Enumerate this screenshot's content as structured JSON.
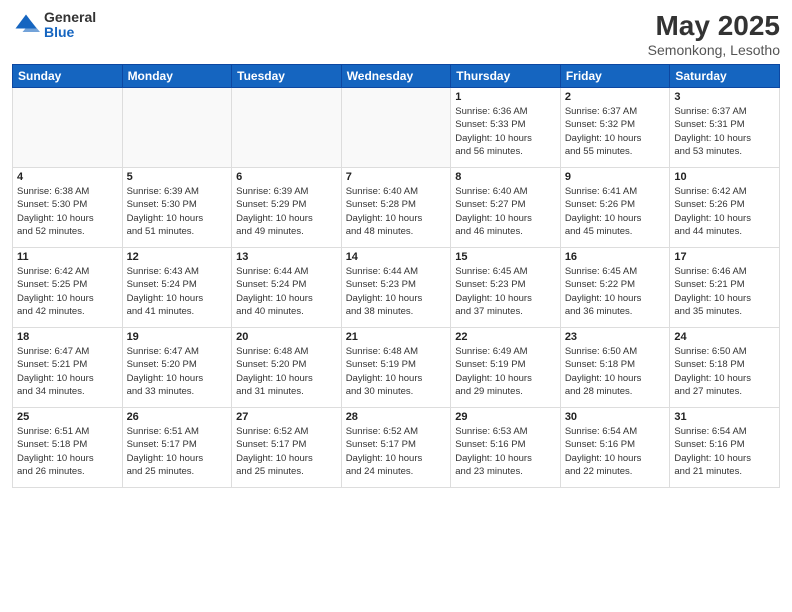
{
  "header": {
    "logo_general": "General",
    "logo_blue": "Blue",
    "title": "May 2025",
    "location": "Semonkong, Lesotho"
  },
  "weekdays": [
    "Sunday",
    "Monday",
    "Tuesday",
    "Wednesday",
    "Thursday",
    "Friday",
    "Saturday"
  ],
  "weeks": [
    [
      {
        "day": "",
        "text": ""
      },
      {
        "day": "",
        "text": ""
      },
      {
        "day": "",
        "text": ""
      },
      {
        "day": "",
        "text": ""
      },
      {
        "day": "1",
        "text": "Sunrise: 6:36 AM\nSunset: 5:33 PM\nDaylight: 10 hours\nand 56 minutes."
      },
      {
        "day": "2",
        "text": "Sunrise: 6:37 AM\nSunset: 5:32 PM\nDaylight: 10 hours\nand 55 minutes."
      },
      {
        "day": "3",
        "text": "Sunrise: 6:37 AM\nSunset: 5:31 PM\nDaylight: 10 hours\nand 53 minutes."
      }
    ],
    [
      {
        "day": "4",
        "text": "Sunrise: 6:38 AM\nSunset: 5:30 PM\nDaylight: 10 hours\nand 52 minutes."
      },
      {
        "day": "5",
        "text": "Sunrise: 6:39 AM\nSunset: 5:30 PM\nDaylight: 10 hours\nand 51 minutes."
      },
      {
        "day": "6",
        "text": "Sunrise: 6:39 AM\nSunset: 5:29 PM\nDaylight: 10 hours\nand 49 minutes."
      },
      {
        "day": "7",
        "text": "Sunrise: 6:40 AM\nSunset: 5:28 PM\nDaylight: 10 hours\nand 48 minutes."
      },
      {
        "day": "8",
        "text": "Sunrise: 6:40 AM\nSunset: 5:27 PM\nDaylight: 10 hours\nand 46 minutes."
      },
      {
        "day": "9",
        "text": "Sunrise: 6:41 AM\nSunset: 5:26 PM\nDaylight: 10 hours\nand 45 minutes."
      },
      {
        "day": "10",
        "text": "Sunrise: 6:42 AM\nSunset: 5:26 PM\nDaylight: 10 hours\nand 44 minutes."
      }
    ],
    [
      {
        "day": "11",
        "text": "Sunrise: 6:42 AM\nSunset: 5:25 PM\nDaylight: 10 hours\nand 42 minutes."
      },
      {
        "day": "12",
        "text": "Sunrise: 6:43 AM\nSunset: 5:24 PM\nDaylight: 10 hours\nand 41 minutes."
      },
      {
        "day": "13",
        "text": "Sunrise: 6:44 AM\nSunset: 5:24 PM\nDaylight: 10 hours\nand 40 minutes."
      },
      {
        "day": "14",
        "text": "Sunrise: 6:44 AM\nSunset: 5:23 PM\nDaylight: 10 hours\nand 38 minutes."
      },
      {
        "day": "15",
        "text": "Sunrise: 6:45 AM\nSunset: 5:23 PM\nDaylight: 10 hours\nand 37 minutes."
      },
      {
        "day": "16",
        "text": "Sunrise: 6:45 AM\nSunset: 5:22 PM\nDaylight: 10 hours\nand 36 minutes."
      },
      {
        "day": "17",
        "text": "Sunrise: 6:46 AM\nSunset: 5:21 PM\nDaylight: 10 hours\nand 35 minutes."
      }
    ],
    [
      {
        "day": "18",
        "text": "Sunrise: 6:47 AM\nSunset: 5:21 PM\nDaylight: 10 hours\nand 34 minutes."
      },
      {
        "day": "19",
        "text": "Sunrise: 6:47 AM\nSunset: 5:20 PM\nDaylight: 10 hours\nand 33 minutes."
      },
      {
        "day": "20",
        "text": "Sunrise: 6:48 AM\nSunset: 5:20 PM\nDaylight: 10 hours\nand 31 minutes."
      },
      {
        "day": "21",
        "text": "Sunrise: 6:48 AM\nSunset: 5:19 PM\nDaylight: 10 hours\nand 30 minutes."
      },
      {
        "day": "22",
        "text": "Sunrise: 6:49 AM\nSunset: 5:19 PM\nDaylight: 10 hours\nand 29 minutes."
      },
      {
        "day": "23",
        "text": "Sunrise: 6:50 AM\nSunset: 5:18 PM\nDaylight: 10 hours\nand 28 minutes."
      },
      {
        "day": "24",
        "text": "Sunrise: 6:50 AM\nSunset: 5:18 PM\nDaylight: 10 hours\nand 27 minutes."
      }
    ],
    [
      {
        "day": "25",
        "text": "Sunrise: 6:51 AM\nSunset: 5:18 PM\nDaylight: 10 hours\nand 26 minutes."
      },
      {
        "day": "26",
        "text": "Sunrise: 6:51 AM\nSunset: 5:17 PM\nDaylight: 10 hours\nand 25 minutes."
      },
      {
        "day": "27",
        "text": "Sunrise: 6:52 AM\nSunset: 5:17 PM\nDaylight: 10 hours\nand 25 minutes."
      },
      {
        "day": "28",
        "text": "Sunrise: 6:52 AM\nSunset: 5:17 PM\nDaylight: 10 hours\nand 24 minutes."
      },
      {
        "day": "29",
        "text": "Sunrise: 6:53 AM\nSunset: 5:16 PM\nDaylight: 10 hours\nand 23 minutes."
      },
      {
        "day": "30",
        "text": "Sunrise: 6:54 AM\nSunset: 5:16 PM\nDaylight: 10 hours\nand 22 minutes."
      },
      {
        "day": "31",
        "text": "Sunrise: 6:54 AM\nSunset: 5:16 PM\nDaylight: 10 hours\nand 21 minutes."
      }
    ]
  ]
}
